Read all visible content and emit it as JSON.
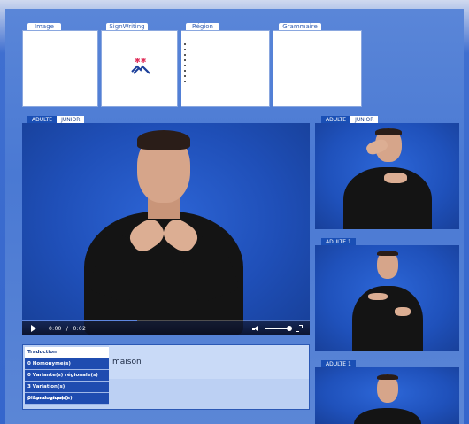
{
  "panels": {
    "image_label": "Image",
    "signwriting_label": "SignWriting",
    "region_label": "Région",
    "grammar_label": "Grammaire"
  },
  "main_video": {
    "tabs": [
      "ADULTE",
      "JUNIOR"
    ],
    "active_tab": "ADULTE",
    "time_current": "0:00",
    "time_separator": "/",
    "time_total": "0:02",
    "progress": 0.4
  },
  "side_videos": {
    "top_tabs": [
      "ADULTE",
      "JUNIOR"
    ],
    "second_label": "ADULTE 1",
    "third_label": "ADULTE 1"
  },
  "info": {
    "header": "Traduction",
    "homonyms": "0 Homonyme(s)",
    "regional_variants": "0 Variante(s) régionale(s)",
    "phonological_variants": "3 Variation(s) phonologique(s)",
    "synonyms": "0 Synonyme(s)",
    "translation": "maison"
  },
  "colors": {
    "accent": "#1f4cb0",
    "background": "#4a79d3"
  }
}
